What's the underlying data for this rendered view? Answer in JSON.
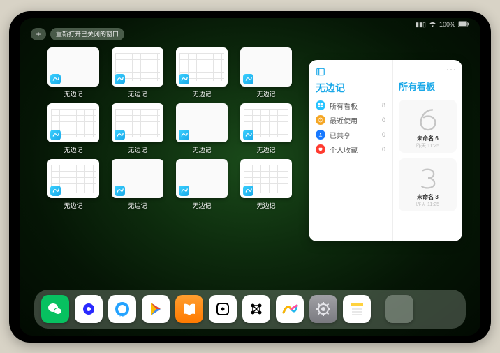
{
  "status_bar": {
    "battery": "100%"
  },
  "top_controls": {
    "plus_label": "+",
    "reopen_label": "重新打开已关闭的窗口"
  },
  "window_grid": {
    "app_label": "无边记",
    "windows": [
      {
        "thumb": "blank"
      },
      {
        "thumb": "cal"
      },
      {
        "thumb": "cal"
      },
      {
        "thumb": "blank"
      },
      {
        "thumb": "cal"
      },
      {
        "thumb": "cal"
      },
      {
        "thumb": "blank"
      },
      {
        "thumb": "cal"
      },
      {
        "thumb": "cal"
      },
      {
        "thumb": "blank"
      },
      {
        "thumb": "blank"
      },
      {
        "thumb": "cal"
      }
    ]
  },
  "side_panel": {
    "left_title": "无边记",
    "items": [
      {
        "color": "#28c3ff",
        "icon": "grid",
        "label": "所有看板",
        "count": "8"
      },
      {
        "color": "#f5a623",
        "icon": "clock",
        "label": "最近使用",
        "count": "0"
      },
      {
        "color": "#1879ff",
        "icon": "people",
        "label": "已共享",
        "count": "0"
      },
      {
        "color": "#ff3b30",
        "icon": "heart",
        "label": "个人收藏",
        "count": "0"
      }
    ],
    "right_title": "所有看板",
    "ellipsis": "···",
    "boards": [
      {
        "sketch": "6",
        "name": "未命名 6",
        "meta": "昨天 11:25"
      },
      {
        "sketch": "3",
        "name": "未命名 3",
        "meta": "昨天 11:25"
      }
    ]
  },
  "dock": {
    "apps": [
      {
        "name": "wechat",
        "bg": "#07c160"
      },
      {
        "name": "quark",
        "bg": "#ffffff"
      },
      {
        "name": "qqbrowser",
        "bg": "#ffffff"
      },
      {
        "name": "play",
        "bg": "#ffffff"
      },
      {
        "name": "books",
        "bg": "#ff9e2f"
      },
      {
        "name": "dice",
        "bg": "#ffffff"
      },
      {
        "name": "grid-app",
        "bg": "#ffffff"
      },
      {
        "name": "freeform",
        "bg": "#ffffff"
      },
      {
        "name": "settings",
        "bg": "#8e8e93"
      },
      {
        "name": "notes",
        "bg": "#ffffff"
      }
    ]
  }
}
